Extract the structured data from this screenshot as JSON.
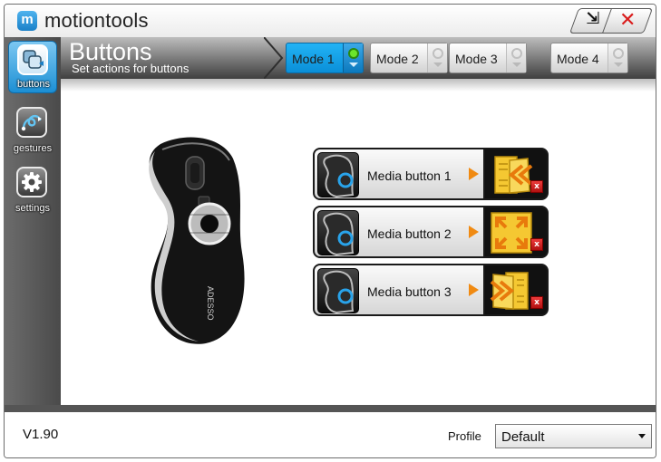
{
  "app": {
    "title": "motiontools",
    "logo_letter": "m"
  },
  "window_controls": {
    "minimize_glyph": "⇲",
    "close_glyph": "✕"
  },
  "sidebar": {
    "items": [
      {
        "label": "buttons",
        "icon": "buttons-icon",
        "active": true
      },
      {
        "label": "gestures",
        "icon": "gestures-icon",
        "active": false
      },
      {
        "label": "settings",
        "icon": "gear-icon",
        "active": false
      }
    ]
  },
  "header": {
    "title": "Buttons",
    "subtitle": "Set actions for buttons"
  },
  "modes": [
    {
      "label": "Mode 1",
      "active": true
    },
    {
      "label": "Mode 2",
      "active": false
    },
    {
      "label": "Mode 3",
      "active": false
    },
    {
      "label": "Mode 4",
      "active": false
    }
  ],
  "mouse": {
    "brand": "ADESSO"
  },
  "media_buttons": [
    {
      "label": "Media button 1",
      "action_icon": "rewind-pages-icon"
    },
    {
      "label": "Media button 2",
      "action_icon": "fullscreen-arrows-icon"
    },
    {
      "label": "Media button 3",
      "action_icon": "forward-pages-icon"
    }
  ],
  "remove_glyph": "x",
  "footer": {
    "version": "V1.90",
    "profile_label": "Profile",
    "profile_value": "Default"
  },
  "colors": {
    "accent": "#0a8fd8",
    "active_mode_led": "#6be52b",
    "action_orange": "#f08a12",
    "remove_red": "#d41c1c"
  }
}
